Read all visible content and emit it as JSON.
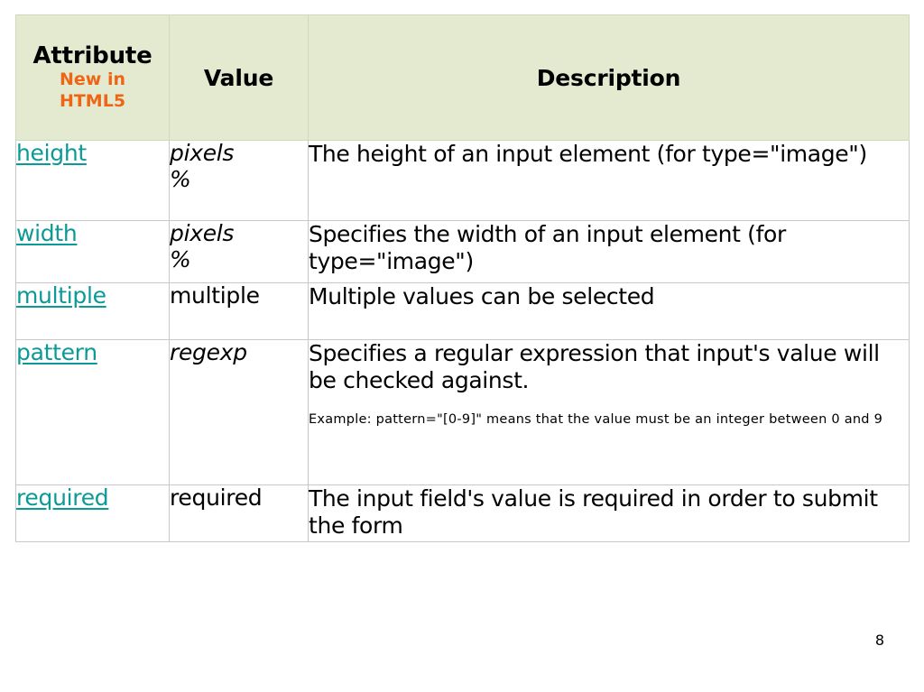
{
  "slide": {
    "page_number": "8",
    "colors": {
      "header_background": "#e4ead0",
      "link_teal": "#0c9a96",
      "accent_orange": "#ee6615",
      "border_gray": "#c8c8c8",
      "text_black": "#000000",
      "page_background": "#ffffff"
    }
  },
  "table": {
    "headers": {
      "attribute_main": "Attribute",
      "attribute_sub_line1": "New in",
      "attribute_sub_line2": "HTML5",
      "value": "Value",
      "description": "Description"
    },
    "rows": [
      {
        "attribute": "height",
        "value_lines": [
          "pixels",
          "%"
        ],
        "value_style": "italic",
        "description": "The height of an input element (for type=\"image\")",
        "example": ""
      },
      {
        "attribute": "width",
        "value_lines": [
          "pixels",
          "%"
        ],
        "value_style": "italic",
        "description": "Specifies the width of an input element (for type=\"image\")",
        "example": ""
      },
      {
        "attribute": "multiple",
        "value_lines": [
          "multiple"
        ],
        "value_style": "normal",
        "description": "Multiple values can be selected",
        "example": ""
      },
      {
        "attribute": "pattern",
        "value_lines": [
          "regexp"
        ],
        "value_style": "italic",
        "description": "Specifies a regular expression that input's value will be checked against.",
        "example": "Example: pattern=\"[0-9]\" means that the value must be an integer between 0 and 9"
      },
      {
        "attribute": "required",
        "value_lines": [
          "required"
        ],
        "value_style": "normal",
        "description": "The input field's value is required in order to submit the form",
        "example": ""
      }
    ]
  }
}
